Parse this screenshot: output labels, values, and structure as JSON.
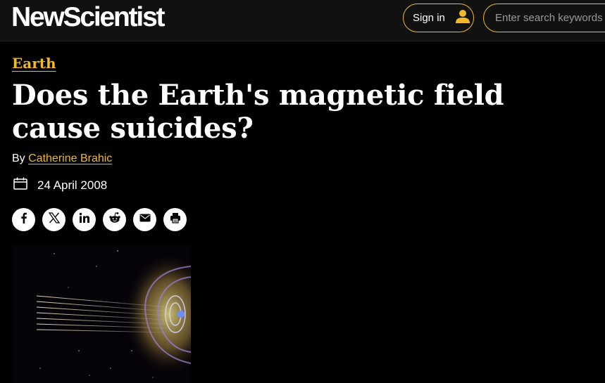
{
  "header": {
    "logo": "NewScientist",
    "signin_label": "Sign in",
    "search_placeholder": "Enter search keywords"
  },
  "article": {
    "category": "Earth",
    "title": "Does the Earth's magnetic field cause suicides?",
    "byline_prefix": "By",
    "author": "Catherine Brahic",
    "date": "24 April 2008"
  },
  "share": {
    "icons": [
      "facebook-icon",
      "x-icon",
      "linkedin-icon",
      "reddit-icon",
      "email-icon",
      "print-icon"
    ]
  },
  "colors": {
    "accent": "#f0b92b",
    "background": "#000000",
    "header_background": "#111111"
  }
}
